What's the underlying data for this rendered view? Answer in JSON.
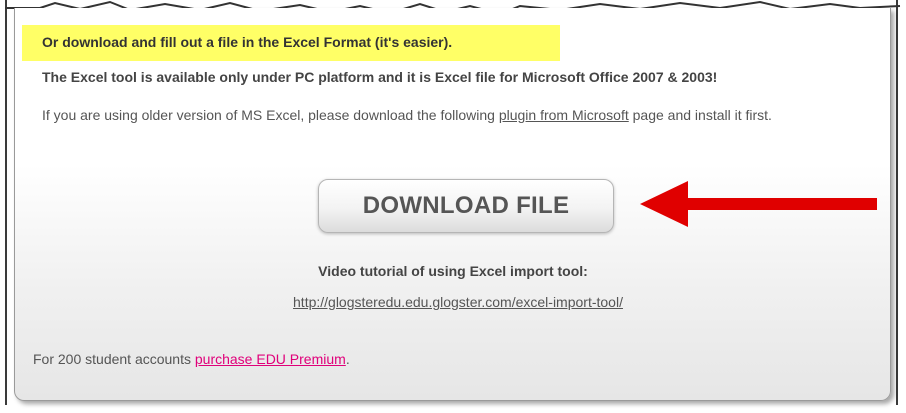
{
  "highlight": {
    "text": "Or download and fill out a file in the Excel Format (it's easier).",
    "color": "#ffff66"
  },
  "notice": {
    "bold_text": "The Excel tool is available only under PC platform and it is Excel file for Microsoft Office 2007 & 2003!"
  },
  "plugin_note": {
    "before": "If you are using older version of MS Excel, please download the following ",
    "link_text": "plugin from Microsoft",
    "after": " page and install it first."
  },
  "download": {
    "button_label": "DOWNLOAD FILE"
  },
  "annotation": {
    "arrow_color": "#e00000",
    "arrow_icon": "red-arrow-left"
  },
  "video": {
    "title": "Video tutorial of using Excel import tool:",
    "url": "http://glogsteredu.edu.glogster.com/excel-import-tool/"
  },
  "footer": {
    "prefix": "For 200 student accounts ",
    "link_text": "purchase EDU Premium",
    "suffix": ".",
    "link_color": "#e0007a"
  }
}
